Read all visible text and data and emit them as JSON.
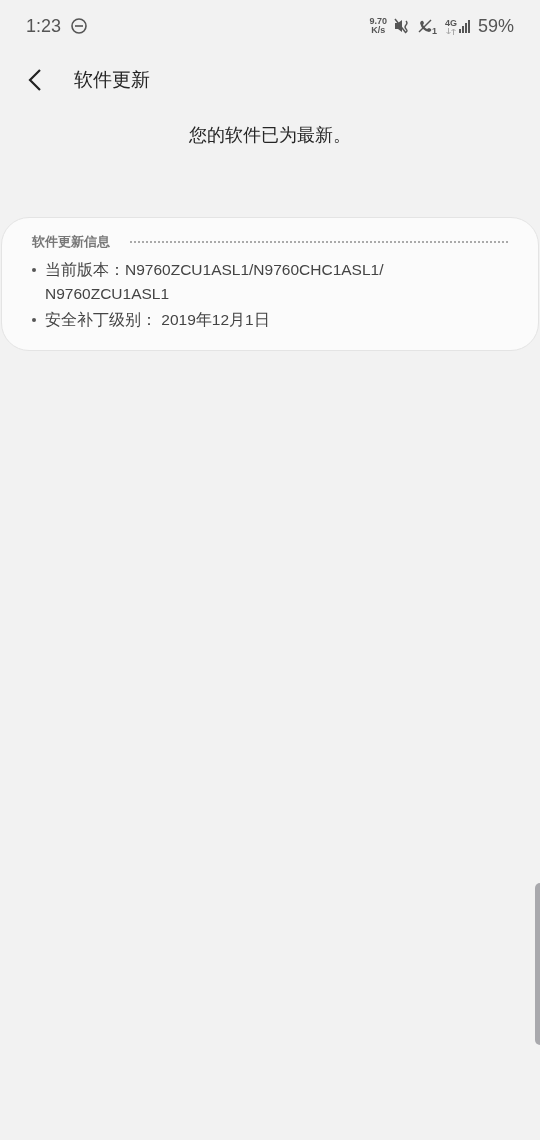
{
  "status_bar": {
    "time": "1:23",
    "net_speed_value": "9.70",
    "net_speed_unit": "K/s",
    "sim_label": "1",
    "network": "4G",
    "battery": "59%"
  },
  "header": {
    "title": "软件更新"
  },
  "message": "您的软件已为最新。",
  "info_card": {
    "heading": "软件更新信息",
    "items": [
      {
        "label": "当前版本：",
        "value": "N9760ZCU1ASL1/N9760CHC1ASL1/ N9760ZCU1ASL1"
      },
      {
        "label": "安全补丁级别：",
        "value": " 2019年12月1日"
      }
    ]
  }
}
